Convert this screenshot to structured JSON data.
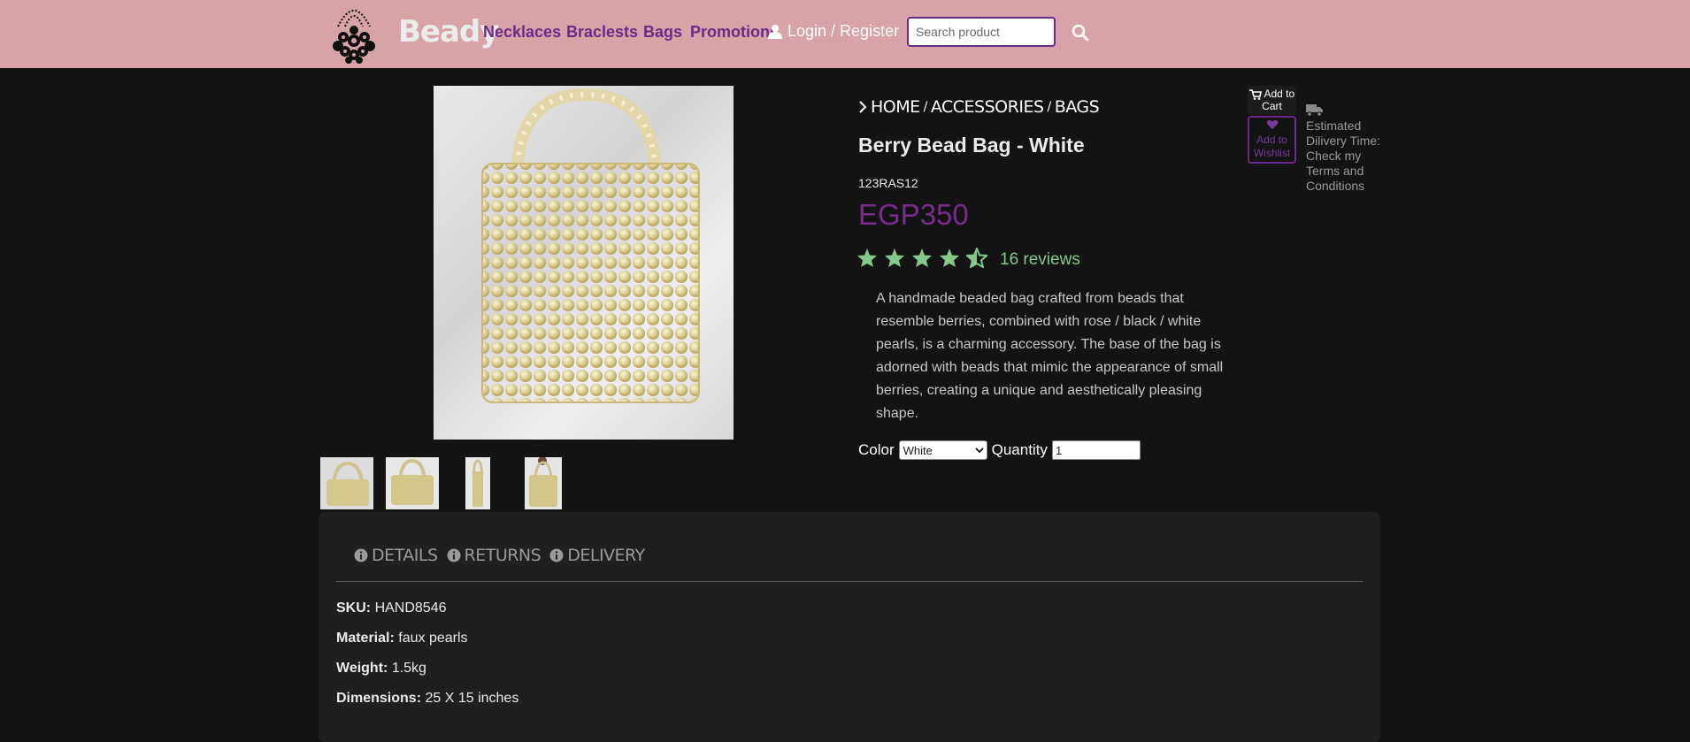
{
  "header": {
    "brand": "Beady",
    "nav": [
      "Necklaces",
      "Braclests",
      "Bags",
      "Promotions"
    ],
    "login_label": "Login / Register",
    "search_placeholder": "Search product",
    "colors": {
      "bar": "#d8a3a6",
      "nav": "#6a2a8a"
    }
  },
  "breadcrumb": [
    "HOME",
    "ACCESSORIES",
    "BAGS"
  ],
  "product": {
    "title": "Berry Bead Bag - White",
    "code": "123RAS12",
    "price": "EGP350",
    "rating": 4.5,
    "reviews": "16 reviews",
    "description": "A handmade beaded bag crafted from beads that resemble berries, combined with rose / black / white pearls, is a charming accessory. The base of the bag is adorned with beads that mimic the appearance of small berries, creating a unique and aesthetically pleasing shape.",
    "color_label": "Color",
    "color_value": "White",
    "quantity_label": "Quantity",
    "quantity_value": "1"
  },
  "actions": {
    "add_to_cart": "Add to Cart",
    "add_to_wishlist": "Add to Wishlist",
    "delivery_note": "Estimated Dilivery Time: Check my Terms and Conditions"
  },
  "tabs": [
    "DETAILS",
    "RETURNS",
    "DELIVERY"
  ],
  "details": [
    {
      "label": "SKU:",
      "value": "HAND8546"
    },
    {
      "label": "Material:",
      "value": "faux pearls"
    },
    {
      "label": "Weight:",
      "value": "1.5kg"
    },
    {
      "label": "Dimensions:",
      "value": "25 X 15 inches"
    }
  ],
  "colors": {
    "accent": "#7a2c8e",
    "stars": "#82c98a"
  }
}
